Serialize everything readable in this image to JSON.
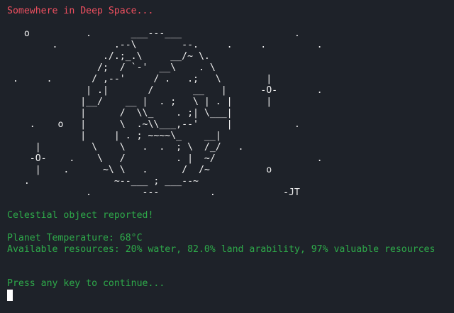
{
  "terminal": {
    "header": "Somewhere in Deep Space...",
    "ascii_art": "   o          .       ___---___                    .\n        .          .--\\        --.     .     .         .\n                 ./.;_.\\     __/~ \\.\n                /;  / `-'  __\\    . \\\n .     .       / ,--'     / .   .;   \\        |\n              | .|       /       __   |      -O-       .\n             |__/    __ |  . ;   \\ | . |      |\n             |      /  \\\\_    . ;| \\___|\n    .    o   |      \\  .~\\\\___,--'     |           .\n             |     | . ; ~~~~\\_    __|\n     |         \\    \\   .  .  ; \\  /_/   .\n    -O-    .    \\   /         . |  ~/                  .\n     |    .      ~\\ \\   .      /  /~          o\n   .               ~--___ ; ___--~\n              .         ---         .            -JT",
    "report": "Celestial object reported!",
    "temperature": "Planet Temperature: 68°C",
    "resources": "Available resources: 20% water, 82.0% land arability, 97% valuable resources",
    "prompt": "Press any key to continue..."
  },
  "colors": {
    "background": "#1e2229",
    "header": "#f05060",
    "art": "#f2f2f2",
    "text": "#2eaa4a",
    "cursor": "#ffffff"
  }
}
